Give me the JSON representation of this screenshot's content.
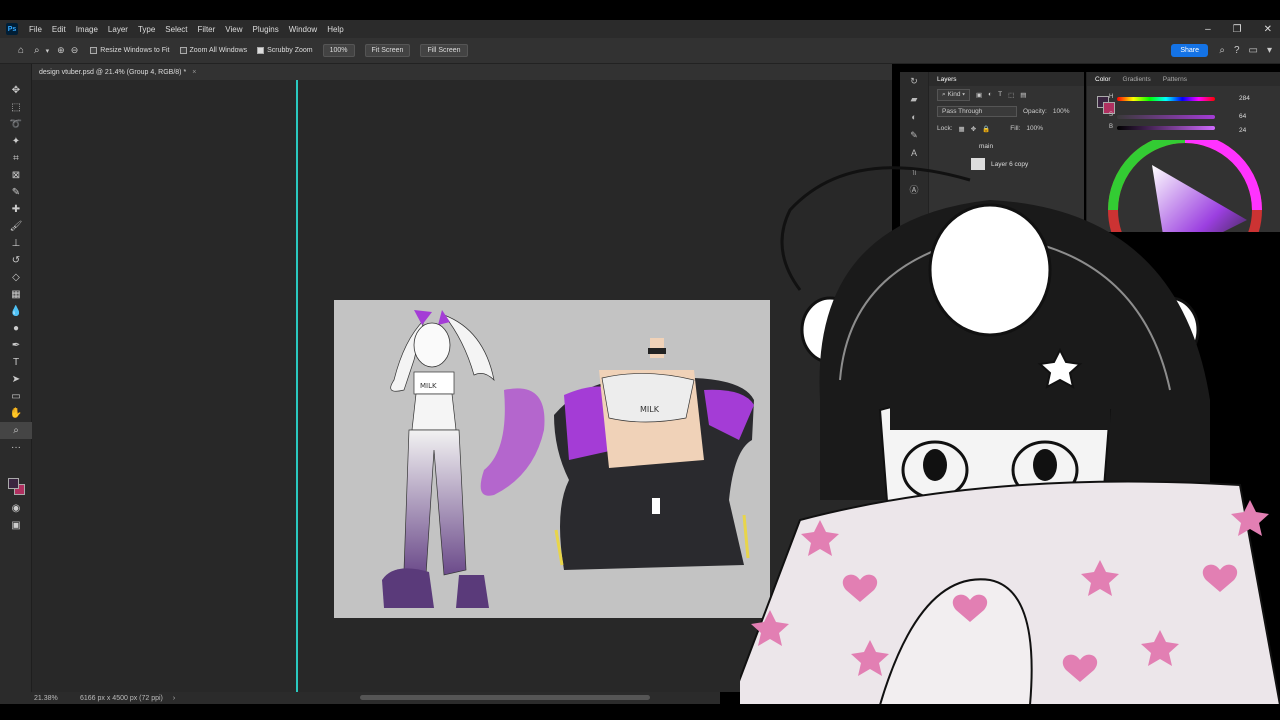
{
  "menubar": {
    "app_logo": "Ps",
    "items": [
      "File",
      "Edit",
      "Image",
      "Layer",
      "Type",
      "Select",
      "Filter",
      "View",
      "Plugins",
      "Window",
      "Help"
    ]
  },
  "options_bar": {
    "resize_windows": "Resize Windows to Fit",
    "zoom_all": "Zoom All Windows",
    "scrubby_zoom": "Scrubby Zoom",
    "zoom_value": "100%",
    "fit_screen": "Fit Screen",
    "fill_screen": "Fill Screen",
    "share": "Share"
  },
  "document": {
    "tab_title": "design vtuber.psd @ 21.4% (Group 4, RGB/8) *",
    "close": "×"
  },
  "status": {
    "zoom": "21.38%",
    "doc_info": "6166 px x 4500 px (72 ppi)"
  },
  "layers_panel": {
    "tab": "Layers",
    "kind_label": "Kind",
    "blend_mode": "Pass Through",
    "opacity_label": "Opacity:",
    "opacity_value": "100%",
    "lock_label": "Lock:",
    "fill_label": "Fill:",
    "fill_value": "100%",
    "group_name": "main",
    "layer_name": "Layer 6 copy"
  },
  "color_panel": {
    "tabs": [
      "Color",
      "Gradients",
      "Patterns"
    ],
    "h_value": "284",
    "s_value": "64",
    "b_value": "24",
    "h_label": "H",
    "s_label": "S",
    "b_label": "B"
  },
  "canvas_art": {
    "left_label": "MILK",
    "right_label": "MILK"
  },
  "colors": {
    "accent_purple": "#a43cd6",
    "guide": "#2ac9c0",
    "share_blue": "#1473e6",
    "canvas_bg": "#c3c3c3"
  }
}
